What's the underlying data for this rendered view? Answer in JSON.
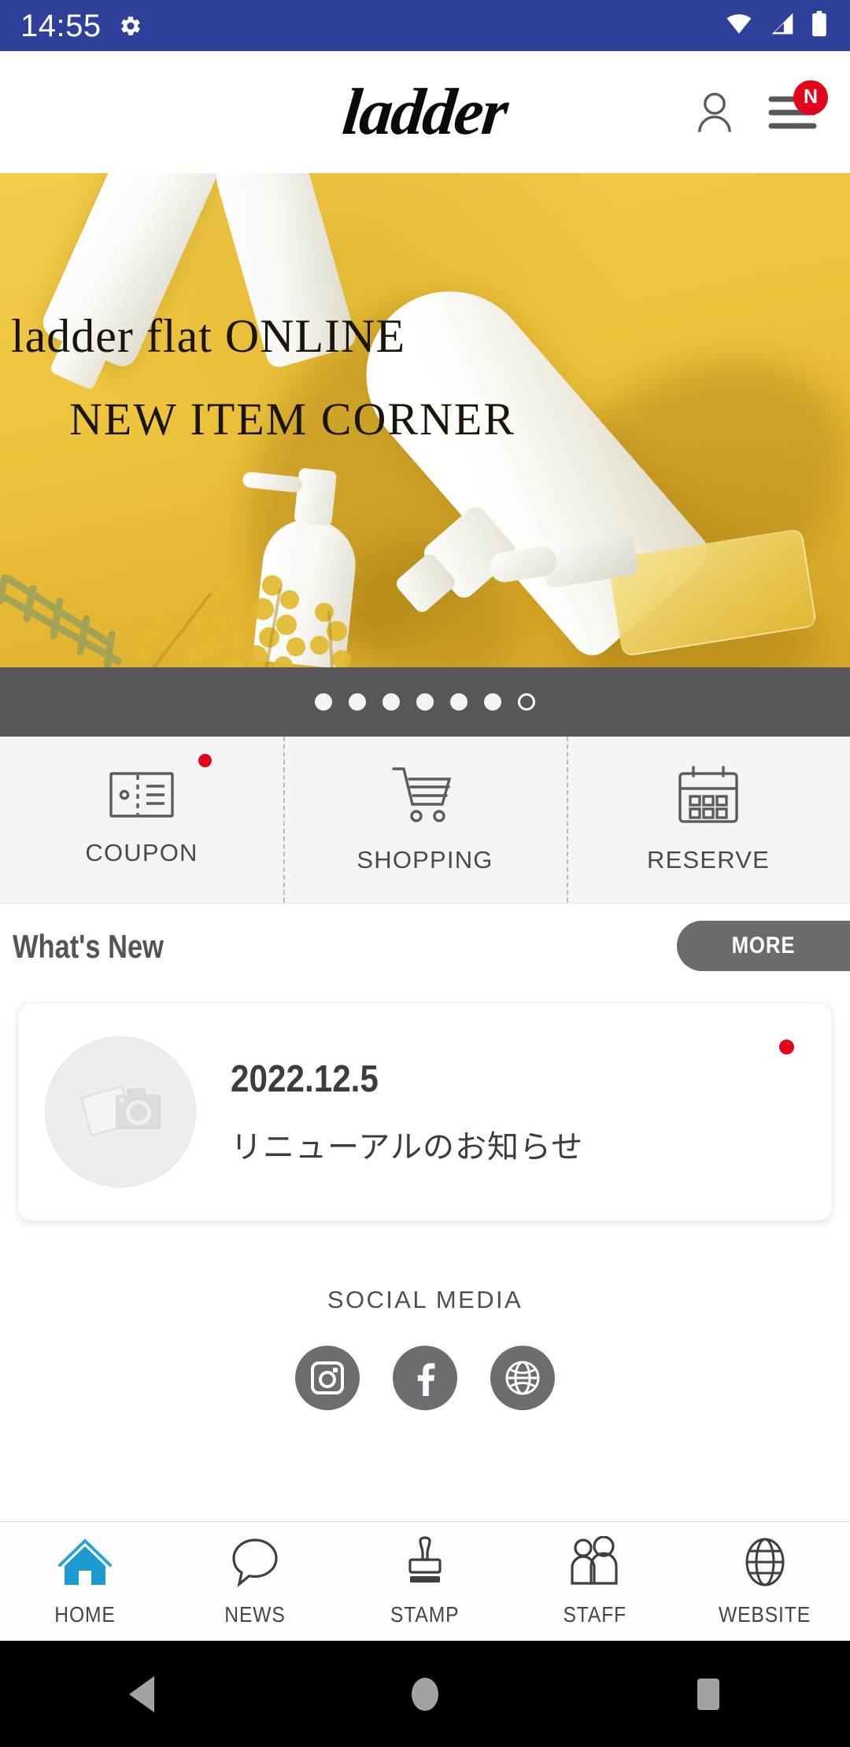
{
  "status_bar": {
    "time": "14:55",
    "icons": [
      "gear-icon",
      "wifi-icon",
      "cellular-signal-icon",
      "battery-icon"
    ],
    "background_color": "#2f409a"
  },
  "header": {
    "logo_text": "ladder",
    "account_icon": "person-icon",
    "menu_icon": "hamburger-menu-icon",
    "menu_badge_label": "N",
    "badge_color": "#e3051b"
  },
  "hero": {
    "line1": "ladder flat ONLINE",
    "line2": "NEW ITEM CORNER",
    "background_color": "#efc23f"
  },
  "carousel": {
    "total_dots": 7,
    "active_index": 6,
    "strip_color": "#59565a"
  },
  "quick_actions": [
    {
      "label": "COUPON",
      "icon": "coupon-ticket-icon",
      "badge": true
    },
    {
      "label": "SHOPPING",
      "icon": "shopping-cart-icon",
      "badge": false
    },
    {
      "label": "RESERVE",
      "icon": "calendar-icon",
      "badge": false
    }
  ],
  "whats_new": {
    "title": "What's New",
    "more_label": "MORE",
    "more_color": "#6b6b6d",
    "items": [
      {
        "date": "2022.12.5",
        "title": "リニューアルのお知らせ",
        "thumb_icon": "photo-placeholder-icon",
        "unread": true
      }
    ]
  },
  "social_media": {
    "label": "SOCIAL MEDIA",
    "links": [
      {
        "name": "instagram-icon"
      },
      {
        "name": "facebook-icon"
      },
      {
        "name": "globe-icon"
      }
    ],
    "button_color": "#6e6c70"
  },
  "bottom_nav": {
    "active_color": "#1d9bd1",
    "items": [
      {
        "label": "HOME",
        "icon": "home-icon",
        "active": true
      },
      {
        "label": "NEWS",
        "icon": "chat-bubble-icon",
        "active": false
      },
      {
        "label": "STAMP",
        "icon": "stamp-icon",
        "active": false
      },
      {
        "label": "STAFF",
        "icon": "people-icon",
        "active": false
      },
      {
        "label": "WEBSITE",
        "icon": "globe-icon",
        "active": false
      }
    ]
  },
  "system_nav": {
    "buttons": [
      "back-triangle-icon",
      "home-circle-icon",
      "recents-square-icon"
    ]
  }
}
